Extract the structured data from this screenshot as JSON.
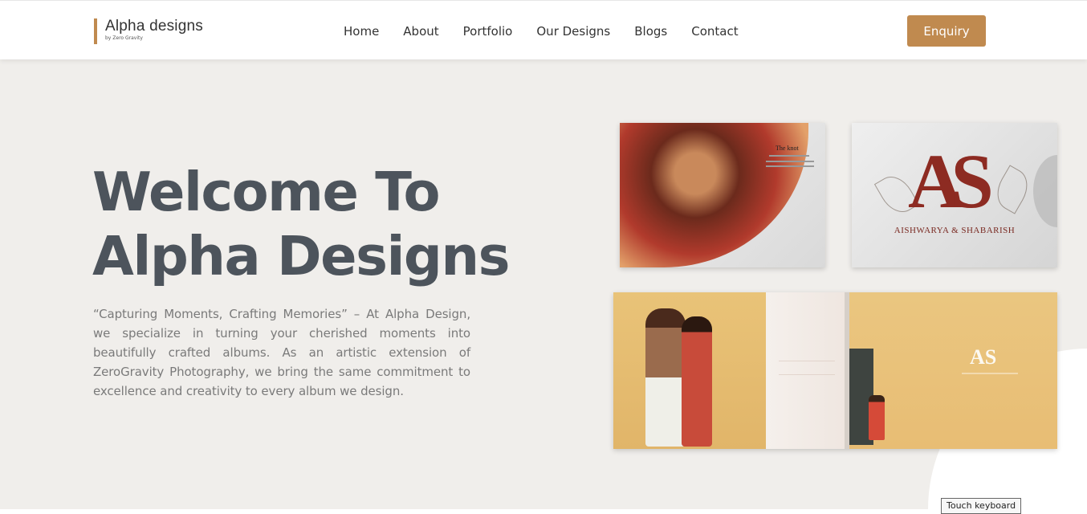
{
  "logo": {
    "title": "Alpha designs",
    "subtitle": "by Zero Gravity"
  },
  "nav": {
    "items": [
      {
        "label": "Home"
      },
      {
        "label": "About"
      },
      {
        "label": "Portfolio"
      },
      {
        "label": "Our Designs"
      },
      {
        "label": "Blogs"
      },
      {
        "label": "Contact"
      }
    ]
  },
  "header": {
    "cta_label": "Enquiry"
  },
  "hero": {
    "title_line1": "Welcome To",
    "title_line2": "Alpha Designs",
    "description": "“Capturing Moments, Crafting Memories” – At Alpha Design, we specialize in turning your cherished moments into beautifully crafted albums. As an artistic extension of ZeroGravity Photography, we bring the same commitment to excellence and creativity to every album we design."
  },
  "albums": {
    "card1_title": "The knot",
    "card2_monogram": "AS",
    "card2_names": "AISHWARYA & SHABARISH",
    "card3_monogram": "AS"
  },
  "system": {
    "touch_keyboard": "Touch keyboard"
  },
  "colors": {
    "accent": "#c08a4f",
    "hero_bg": "#f0eeeb",
    "title": "#4d545c"
  }
}
